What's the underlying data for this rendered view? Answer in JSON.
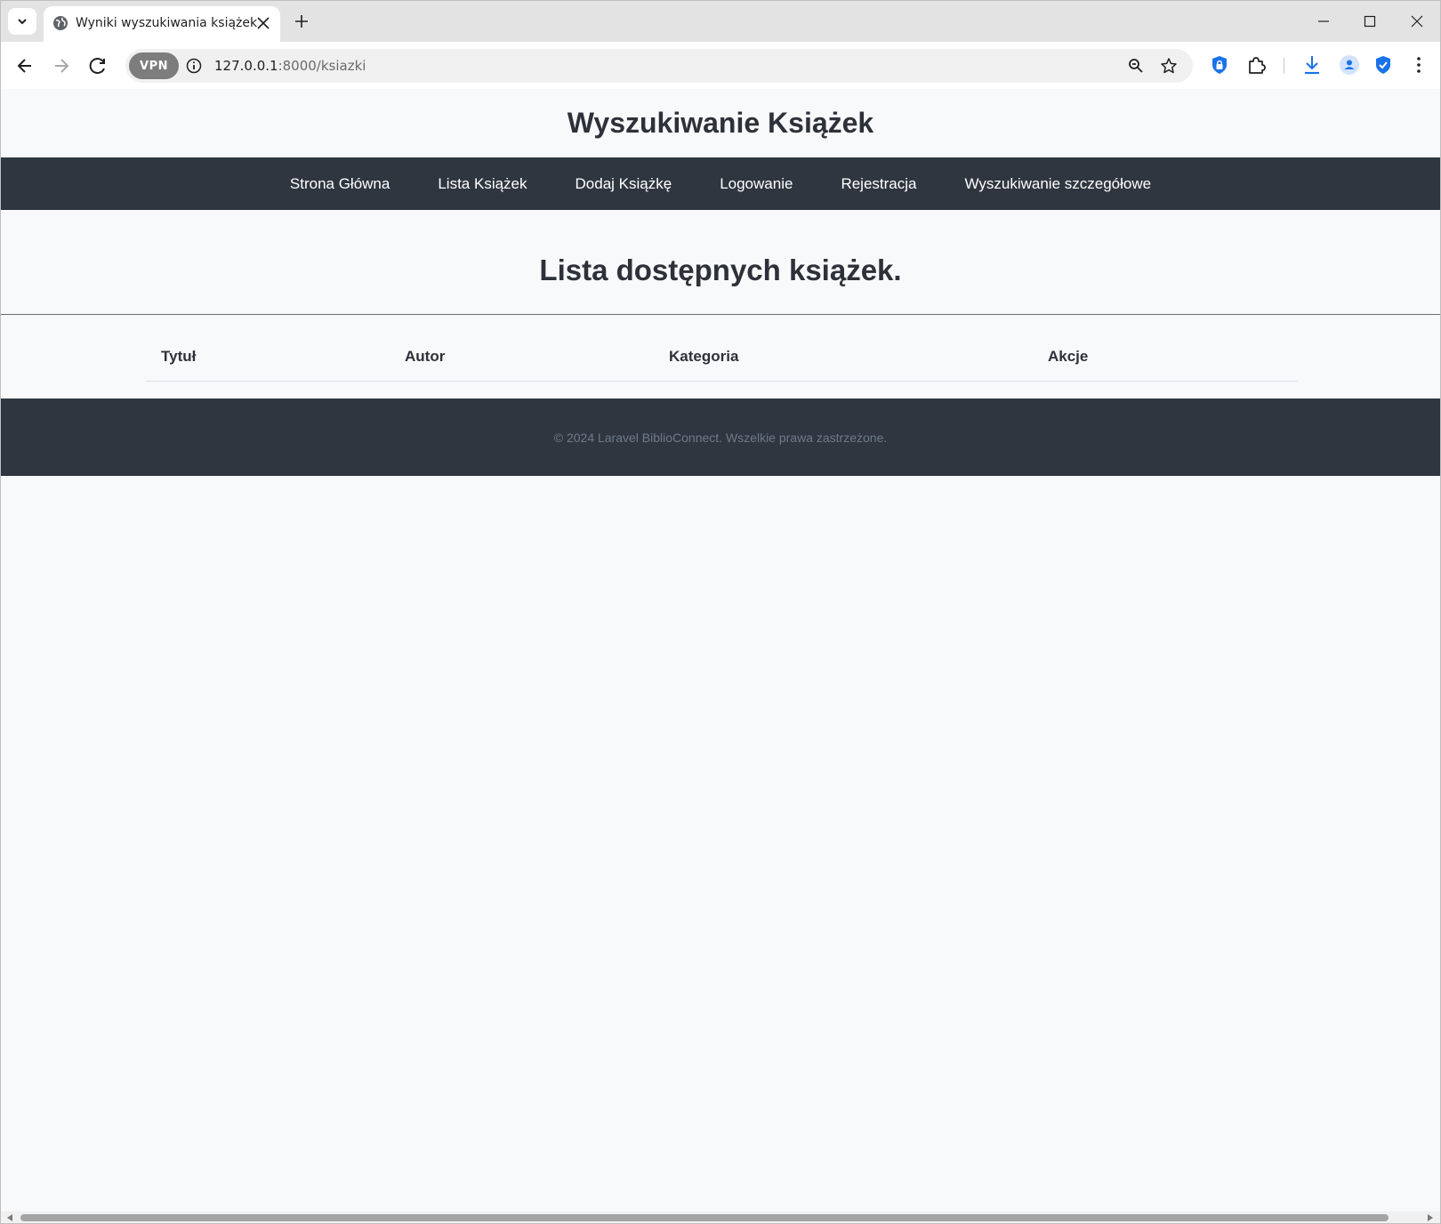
{
  "browser": {
    "tab_title": "Wyniki wyszukiwania książek",
    "url_host": "127.0.0.1",
    "url_rest": ":8000/ksiazki",
    "vpn_label": "VPN"
  },
  "site": {
    "title": "Wyszukiwanie Książek",
    "nav": [
      "Strona Główna",
      "Lista Książek",
      "Dodaj Książkę",
      "Logowanie",
      "Rejestracja",
      "Wyszukiwanie szczegółowe"
    ],
    "heading": "Lista dostępnych książek.",
    "table_headers": [
      "Tytuł",
      "Autor",
      "Kategoria",
      "Akcje"
    ],
    "footer": "© 2024 Laravel BiblioConnect. Wszelkie prawa zastrzeżone."
  },
  "colors": {
    "nav_bg": "#2f3640",
    "page_bg": "#f8f9fa",
    "title_text": "#2d3139",
    "footer_text": "#6f7a87",
    "extension_blue": "#1a73e8"
  },
  "icons": [
    "chevron-down-icon",
    "globe-icon",
    "close-icon",
    "plus-icon",
    "minimize-icon",
    "maximize-icon",
    "back-arrow-icon",
    "forward-arrow-icon",
    "reload-icon",
    "info-icon",
    "zoom-icon",
    "star-icon",
    "password-manager-icon",
    "extensions-icon",
    "download-icon",
    "profile-icon",
    "shield-check-icon",
    "kebab-menu-icon"
  ]
}
